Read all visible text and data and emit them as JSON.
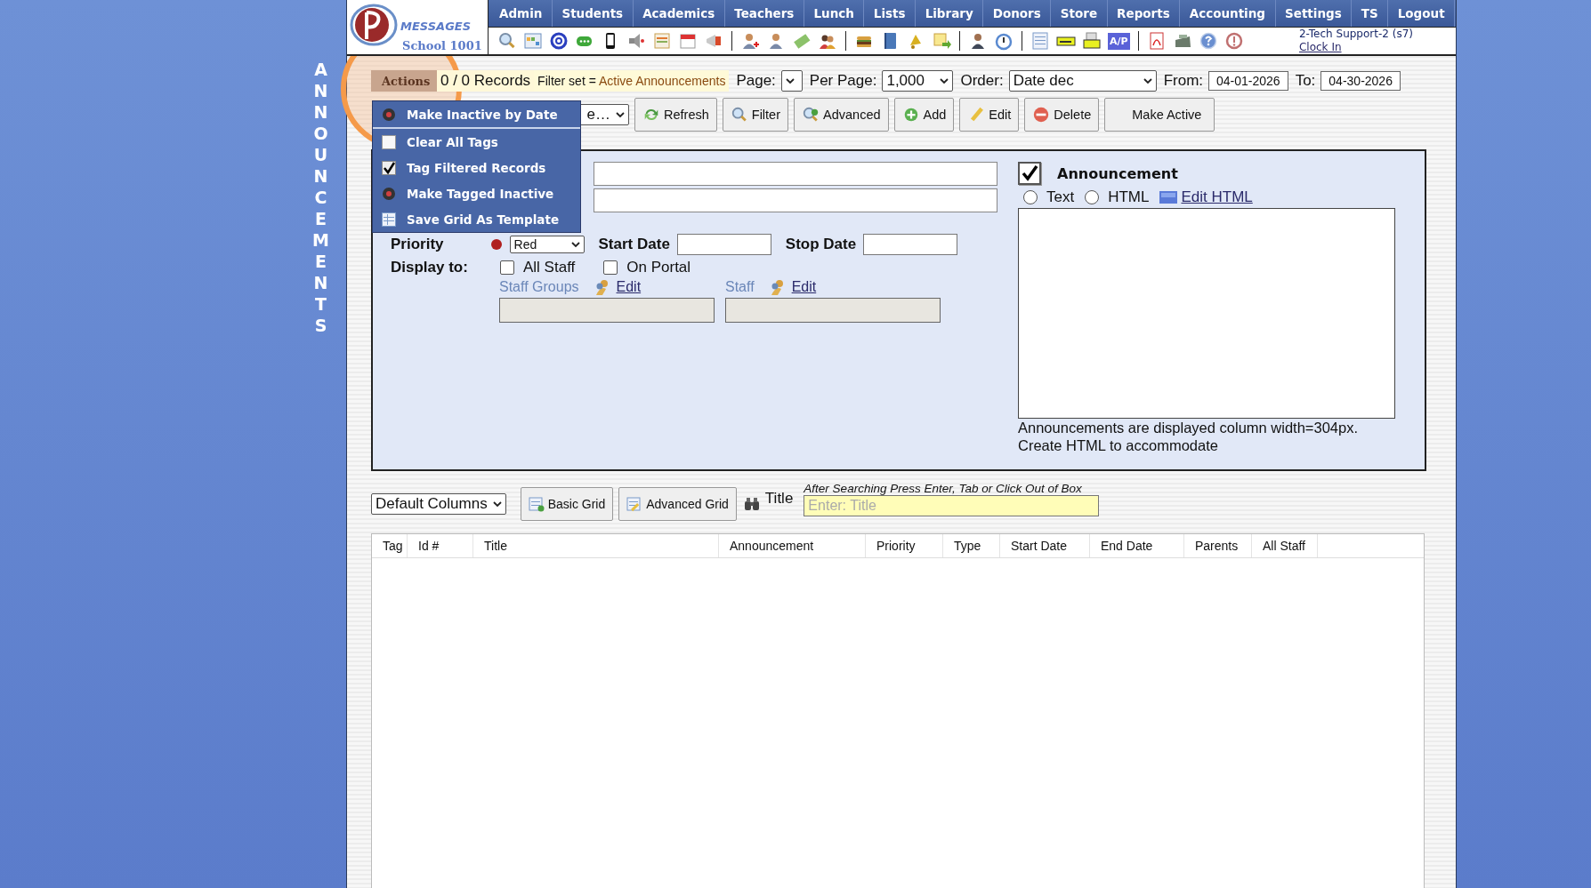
{
  "sidebar_title": "ANNOUNCEMENTS",
  "logo": {
    "title": "MESSAGES",
    "subtitle": "School 1001"
  },
  "nav": [
    "Admin",
    "Students",
    "Academics",
    "Teachers",
    "Lunch",
    "Lists",
    "Library",
    "Donors",
    "Store",
    "Reports",
    "Accounting",
    "Settings",
    "TS",
    "Logout"
  ],
  "ap_badge": "A/P",
  "user": {
    "name": "2-Tech Support-2 (s7)",
    "link": "Clock In"
  },
  "actions_tab": "Actions",
  "actions_menu": [
    {
      "label": "Make Inactive by Date",
      "kind": "dot"
    },
    {
      "label": "Clear All Tags",
      "kind": "blank"
    },
    {
      "label": "Tag Filtered Records",
      "kind": "check"
    },
    {
      "label": "Make Tagged Inactive",
      "kind": "dot"
    },
    {
      "label": "Save Grid As Template",
      "kind": "grid"
    }
  ],
  "records": "0 / 0 Records",
  "filter": {
    "label": "Filter set = ",
    "value": "Active Announcements"
  },
  "page": {
    "label": "Page:"
  },
  "per_page": {
    "label": "Per Page:",
    "value": "1,000"
  },
  "order": {
    "label": "Order:",
    "value": "Date dec"
  },
  "from": {
    "label": "From:",
    "value": "04-01-2026"
  },
  "to": {
    "label": "To:",
    "value": "04-30-2026"
  },
  "view_select": "e…",
  "buttons": [
    {
      "label": "Refresh",
      "kind": "refresh"
    },
    {
      "label": "Filter",
      "kind": "search"
    },
    {
      "label": "Advanced",
      "kind": "advanced"
    },
    {
      "label": "Add",
      "kind": "add"
    },
    {
      "label": "Edit",
      "kind": "edit"
    },
    {
      "label": "Delete",
      "kind": "delete"
    },
    {
      "label": "Make Active",
      "kind": "none"
    }
  ],
  "form": {
    "priority": {
      "label": "Priority",
      "value": "Red"
    },
    "start_date": {
      "label": "Start Date"
    },
    "stop_date": {
      "label": "Stop Date"
    },
    "display_to": {
      "label": "Display to:",
      "options": [
        {
          "label": "All Staff",
          "checked": false
        },
        {
          "label": "On Portal",
          "checked": false
        }
      ]
    },
    "staff_groups": {
      "label": "Staff Groups",
      "link": "Edit"
    },
    "staff": {
      "label": "Staff",
      "link": "Edit"
    },
    "announcement": {
      "label": "Announcement",
      "checked": true
    },
    "format": [
      {
        "label": "Text",
        "selected": false
      },
      {
        "label": "HTML",
        "selected": false
      }
    ],
    "edit_html": "Edit HTML",
    "note": [
      "Announcements are displayed column width=304px.",
      "Create HTML to accommodate"
    ]
  },
  "grid_tools": {
    "columns_select": "Default Columns",
    "buttons": [
      "Basic Grid",
      "Advanced Grid"
    ],
    "search_label": "Title",
    "hint": "After Searching Press Enter, Tab or Click Out of Box",
    "placeholder": "Enter: Title"
  },
  "table": {
    "columns": [
      "Tag",
      "Id #",
      "Title",
      "Announcement",
      "Priority",
      "Type",
      "Start Date",
      "End Date",
      "Parents",
      "All Staff"
    ]
  }
}
